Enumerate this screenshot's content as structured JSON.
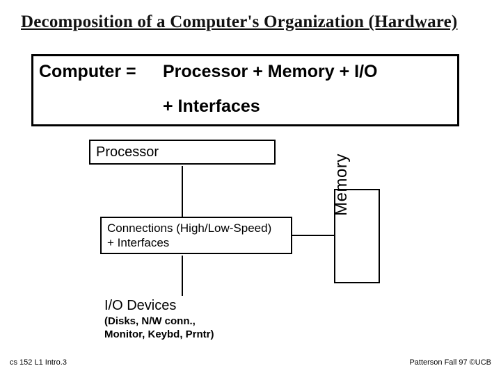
{
  "title": "Decomposition of a Computer's Organization (Hardware)",
  "equation": {
    "lhs": "Computer =",
    "rhs_line1": "Processor + Memory + I/O",
    "rhs_line2": "+ Interfaces"
  },
  "diagram": {
    "processor_label": "Processor",
    "connections_line1": "Connections (High/Low-Speed)",
    "connections_line2": "+ Interfaces",
    "memory_label": "Memory",
    "io_title": "I/O Devices",
    "io_sub_line1": "(Disks, N/W conn.,",
    "io_sub_line2": "Monitor, Keybd, Prntr)"
  },
  "footer": {
    "left": "cs 152 L1 Intro.3",
    "right": "Patterson Fall 97 ©UCB"
  }
}
